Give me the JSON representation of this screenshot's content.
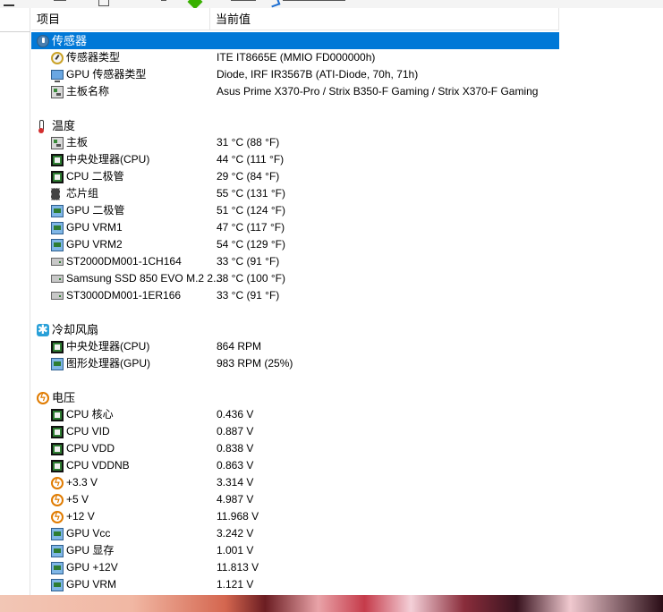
{
  "header": {
    "col_item": "项目",
    "col_value": "当前值"
  },
  "rows": [
    {
      "kind": "cat",
      "icon": "sensor-icon",
      "name": "传感器",
      "value": "",
      "selected": true
    },
    {
      "kind": "item",
      "icon": "gauge-icon",
      "name": "传感器类型",
      "value": "ITE IT8665E  (MMIO FD000000h)"
    },
    {
      "kind": "item",
      "icon": "monitor-icon",
      "name": "GPU 传感器类型",
      "value": "Diode, IRF IR3567B  (ATI-Diode, 70h, 71h)"
    },
    {
      "kind": "item",
      "icon": "motherboard-icon",
      "name": "主板名称",
      "value": "Asus Prime X370-Pro / Strix B350-F Gaming / Strix X370-F Gaming"
    },
    {
      "kind": "blank"
    },
    {
      "kind": "cat",
      "icon": "thermometer-icon",
      "name": "温度",
      "value": ""
    },
    {
      "kind": "item",
      "icon": "motherboard-icon",
      "name": "主板",
      "value": "31 °C  (88 °F)"
    },
    {
      "kind": "item",
      "icon": "cpu-chip-icon",
      "name": "中央处理器(CPU)",
      "value": "44 °C  (111 °F)"
    },
    {
      "kind": "item",
      "icon": "cpu-chip-icon",
      "name": "CPU 二极管",
      "value": "29 °C  (84 °F)"
    },
    {
      "kind": "item",
      "icon": "chipset-icon",
      "name": "芯片组",
      "value": "55 °C  (131 °F)"
    },
    {
      "kind": "item",
      "icon": "gpu-icon",
      "name": "GPU 二极管",
      "value": "51 °C  (124 °F)"
    },
    {
      "kind": "item",
      "icon": "gpu-icon",
      "name": "GPU VRM1",
      "value": "47 °C  (117 °F)"
    },
    {
      "kind": "item",
      "icon": "gpu-icon",
      "name": "GPU VRM2",
      "value": "54 °C  (129 °F)"
    },
    {
      "kind": "item",
      "icon": "disk-icon",
      "name": "ST2000DM001-1CH164",
      "value": "33 °C  (91 °F)"
    },
    {
      "kind": "item",
      "icon": "disk-icon",
      "name": "Samsung SSD 850 EVO M.2 2...",
      "value": "38 °C  (100 °F)"
    },
    {
      "kind": "item",
      "icon": "disk-icon",
      "name": "ST3000DM001-1ER166",
      "value": "33 °C  (91 °F)"
    },
    {
      "kind": "blank"
    },
    {
      "kind": "cat",
      "icon": "fan-icon",
      "name": "冷却风扇",
      "value": ""
    },
    {
      "kind": "item",
      "icon": "cpu-chip-icon",
      "name": "中央处理器(CPU)",
      "value": "864 RPM"
    },
    {
      "kind": "item",
      "icon": "gpu-icon",
      "name": "图形处理器(GPU)",
      "value": "983 RPM  (25%)"
    },
    {
      "kind": "blank"
    },
    {
      "kind": "cat",
      "icon": "voltage-icon",
      "name": "电压",
      "value": ""
    },
    {
      "kind": "item",
      "icon": "cpu-chip-icon",
      "name": "CPU 核心",
      "value": "0.436 V"
    },
    {
      "kind": "item",
      "icon": "cpu-chip-icon",
      "name": "CPU VID",
      "value": "0.887 V"
    },
    {
      "kind": "item",
      "icon": "cpu-chip-icon",
      "name": "CPU VDD",
      "value": "0.838 V"
    },
    {
      "kind": "item",
      "icon": "cpu-chip-icon",
      "name": "CPU VDDNB",
      "value": "0.863 V"
    },
    {
      "kind": "item",
      "icon": "voltage-icon",
      "name": "+3.3 V",
      "value": "3.314 V"
    },
    {
      "kind": "item",
      "icon": "voltage-icon",
      "name": "+5 V",
      "value": "4.987 V"
    },
    {
      "kind": "item",
      "icon": "voltage-icon",
      "name": "+12 V",
      "value": "11.968 V"
    },
    {
      "kind": "item",
      "icon": "gpu-icon",
      "name": "GPU Vcc",
      "value": "3.242 V"
    },
    {
      "kind": "item",
      "icon": "gpu-icon",
      "name": "GPU 显存",
      "value": "1.001 V"
    },
    {
      "kind": "item",
      "icon": "gpu-icon",
      "name": "GPU +12V",
      "value": "11.813 V"
    },
    {
      "kind": "item",
      "icon": "gpu-icon",
      "name": "GPU VRM",
      "value": "1.121 V"
    }
  ]
}
